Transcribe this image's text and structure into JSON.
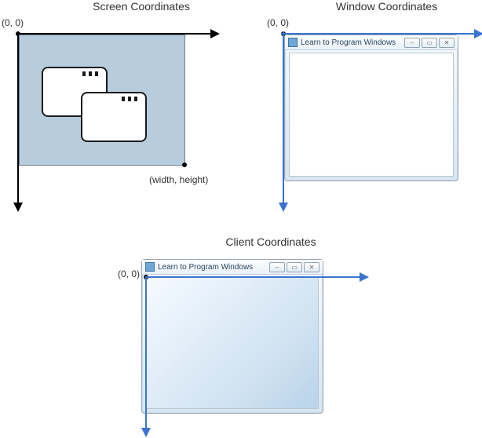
{
  "panels": {
    "screen": {
      "title": "Screen Coordinates",
      "origin_label": "(0, 0)",
      "extent_label": "(width, height)"
    },
    "window": {
      "title": "Window Coordinates",
      "origin_label": "(0, 0)",
      "window_title": "Learn to Program Windows"
    },
    "client": {
      "title": "Client Coordinates",
      "origin_label": "(0, 0)",
      "window_title": "Learn to Program Windows"
    }
  },
  "colors": {
    "axis_black": "#000000",
    "axis_blue": "#3b73d1",
    "screen_fill": "#b7cddd"
  }
}
